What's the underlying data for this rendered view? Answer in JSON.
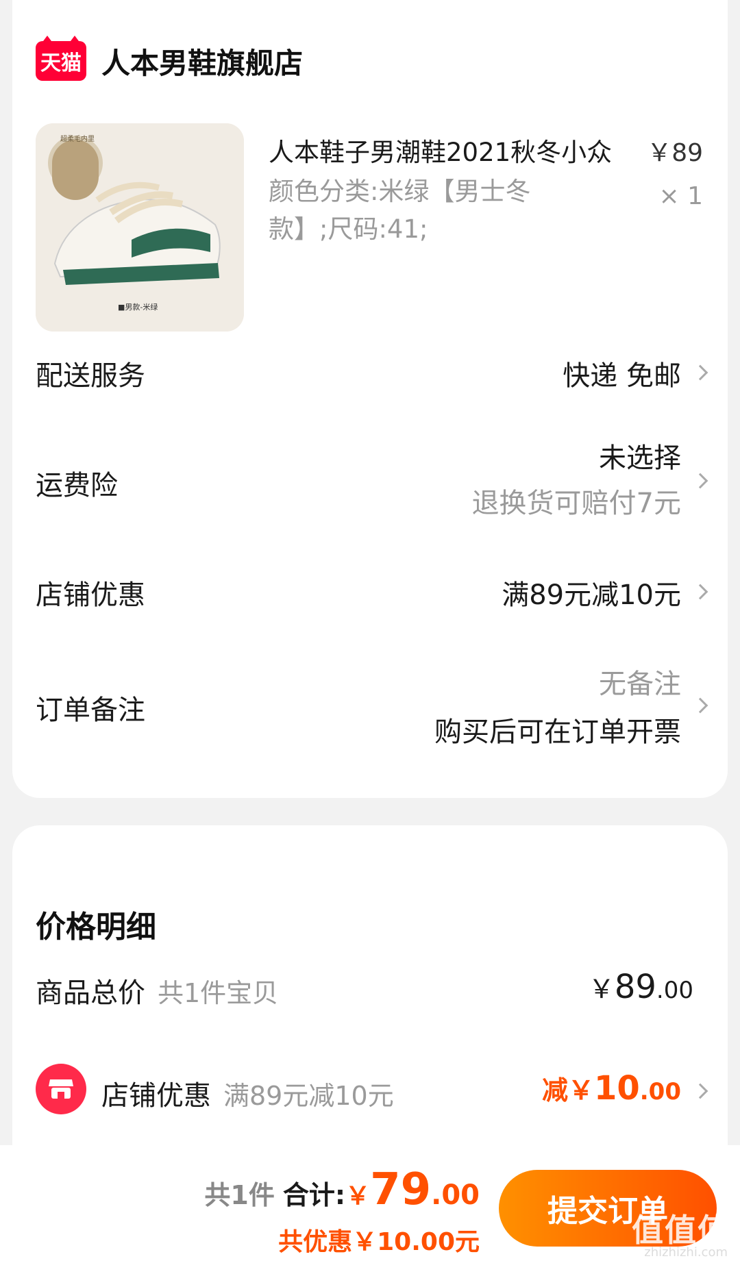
{
  "store": {
    "logo_text": "天猫",
    "name": "人本男鞋旗舰店"
  },
  "product": {
    "title": "人本鞋子男潮鞋2021秋冬小众",
    "price": "￥89",
    "sku": "颜色分类:米绿【男士冬款】;尺码:41;",
    "qty": "× 1",
    "image_badge": "超柔毛内里",
    "image_caption": "■男款-米绿"
  },
  "rows": {
    "delivery": {
      "label": "配送服务",
      "value": "快递 免邮"
    },
    "insurance": {
      "label": "运费险",
      "value": "未选择",
      "sub": "退换货可赔付7元"
    },
    "store_discount": {
      "label": "店铺优惠",
      "value": "满89元减10元"
    },
    "note": {
      "label": "订单备注",
      "value": "无备注",
      "sub": "购买后可在订单开票"
    }
  },
  "price_detail": {
    "title": "价格明细",
    "total": {
      "label": "商品总价",
      "note": "共1件宝贝",
      "yuan": "￥",
      "int": "89",
      "dec": ".00"
    },
    "discount": {
      "label": "店铺优惠",
      "note": "满89元减10元",
      "prefix": "减￥",
      "int": "10",
      "dec": ".00"
    }
  },
  "bottom": {
    "count": "共1件",
    "total_label": "合计:",
    "yuan": "￥",
    "int": "79",
    "dec": ".00",
    "saving": "共优惠￥10.00元",
    "submit": "提交订单"
  },
  "watermark": {
    "main": "值值值",
    "sub": "zhizhizhi.com"
  },
  "colors": {
    "accent": "#ff5000",
    "tmall_red": "#ff0036",
    "store_icon": "#ff2a4a"
  }
}
